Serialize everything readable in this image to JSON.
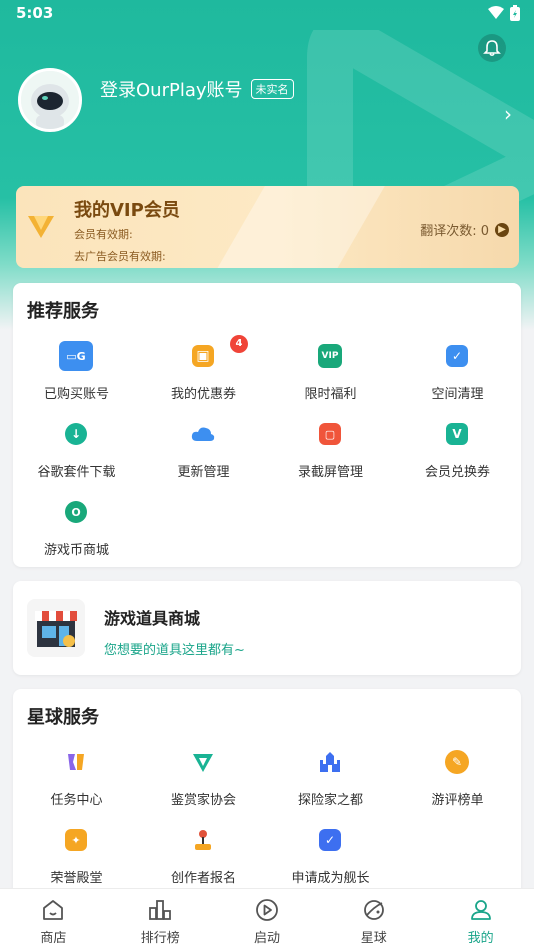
{
  "status_bar": {
    "time": "5:03"
  },
  "profile": {
    "login_text": "登录OurPlay账号",
    "realname_badge": "未实名"
  },
  "vip": {
    "title": "我的VIP会员",
    "validity_label": "会员有效期:",
    "ad_free_label": "去广告会员有效期:",
    "translate_label": "翻译次数: 0"
  },
  "recommended": {
    "title": "推荐服务",
    "items": [
      {
        "label": "已购买账号",
        "icon": "account-cards-icon",
        "color": "#3d8ff0"
      },
      {
        "label": "我的优惠券",
        "icon": "coupon-icon",
        "color": "#f5a623",
        "badge": "4"
      },
      {
        "label": "限时福利",
        "icon": "limited-gift-icon",
        "color": "#19a87a"
      },
      {
        "label": "空间清理",
        "icon": "broom-icon",
        "color": "#3d8ff0"
      },
      {
        "label": "谷歌套件下载",
        "icon": "download-icon",
        "color": "#19b394"
      },
      {
        "label": "更新管理",
        "icon": "cloud-icon",
        "color": "#3d8ff0"
      },
      {
        "label": "录截屏管理",
        "icon": "screen-record-icon",
        "color": "#f0553a"
      },
      {
        "label": "会员兑换券",
        "icon": "vip-voucher-icon",
        "color": "#19b394"
      },
      {
        "label": "游戏币商城",
        "icon": "coin-shop-icon",
        "color": "#19a87a"
      }
    ]
  },
  "item_shop": {
    "title": "游戏道具商城",
    "subtitle": "您想要的道具这里都有~"
  },
  "planet": {
    "title": "星球服务",
    "items": [
      {
        "label": "任务中心",
        "icon": "task-icon",
        "color": "#8a66e8"
      },
      {
        "label": "鉴赏家协会",
        "icon": "connoisseur-icon",
        "color": "#19b394"
      },
      {
        "label": "探险家之都",
        "icon": "castle-icon",
        "color": "#3d6ff0"
      },
      {
        "label": "游评榜单",
        "icon": "review-leaf-icon",
        "color": "#f5a623"
      },
      {
        "label": "荣誉殿堂",
        "icon": "honor-icon",
        "color": "#f5a623"
      },
      {
        "label": "创作者报名",
        "icon": "joystick-icon",
        "color": "#e0523a"
      },
      {
        "label": "申请成为舰长",
        "icon": "captain-icon",
        "color": "#3d6ff0"
      }
    ]
  },
  "bottom_nav": {
    "items": [
      {
        "label": "商店",
        "icon": "store-icon"
      },
      {
        "label": "排行榜",
        "icon": "ranking-icon"
      },
      {
        "label": "启动",
        "icon": "play-icon"
      },
      {
        "label": "星球",
        "icon": "planet-icon"
      },
      {
        "label": "我的",
        "icon": "profile-icon",
        "active": true
      }
    ]
  }
}
